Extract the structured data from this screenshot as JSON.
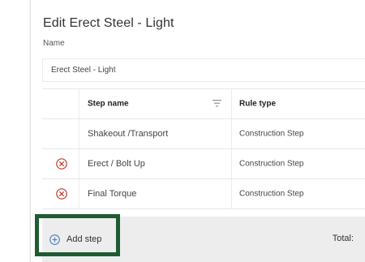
{
  "panel": {
    "title": "Edit Erect Steel - Light",
    "name_label": "Name",
    "name_value": "Erect Steel - Light"
  },
  "table": {
    "headers": {
      "step_name": "Step name",
      "rule_type": "Rule type"
    },
    "rows": [
      {
        "step_name": "Shakeout /Transport",
        "rule_type": "Construction Step",
        "removable": false
      },
      {
        "step_name": "Erect / Bolt Up",
        "rule_type": "Construction Step",
        "removable": true
      },
      {
        "step_name": "Final Torque",
        "rule_type": "Construction Step",
        "removable": true
      }
    ]
  },
  "footer": {
    "add_step_label": "Add step",
    "total_label": "Total:"
  },
  "icons": {
    "filter": "filter-icon",
    "remove": "remove-circle-icon",
    "add": "add-circle-icon"
  },
  "colors": {
    "remove_icon": "#c0392b",
    "add_icon": "#3b82c4",
    "highlight_border": "#1d5c31",
    "footer_bg": "#ededed"
  }
}
